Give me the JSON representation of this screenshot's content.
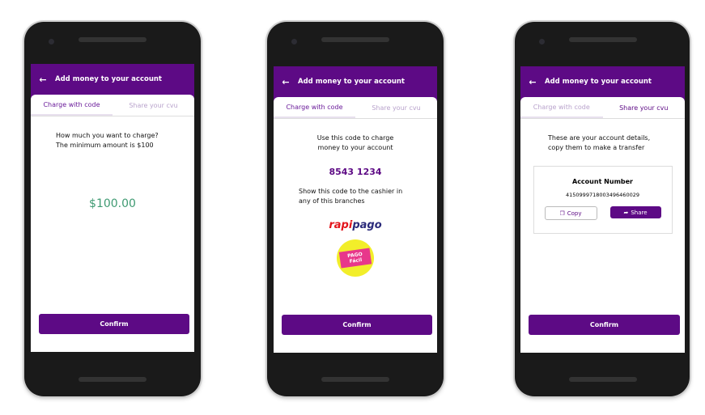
{
  "header_title": "Add money to your account",
  "tabs": {
    "code": "Charge with code",
    "cvu": "Share your cvu"
  },
  "screen1": {
    "line1": "How much you want to charge?",
    "line2": "The minimum amount is $100",
    "amount": "$100.00",
    "confirm": "Confirm"
  },
  "screen2": {
    "line1": "Use this code to charge",
    "line2": "money to your account",
    "code": "8543 1234",
    "line3": "Show this code to the cashier in",
    "line4": "any of this branches",
    "brand1": "rapipago",
    "brand2": "PAGO Fácil",
    "confirm": "Confirm"
  },
  "screen3": {
    "line1": "These are your account details,",
    "line2": "copy them to make a transfer",
    "account_label": "Account Number",
    "account_number": "4150999718003496460029",
    "copy": "Copy",
    "share": "Share",
    "confirm": "Confirm"
  }
}
